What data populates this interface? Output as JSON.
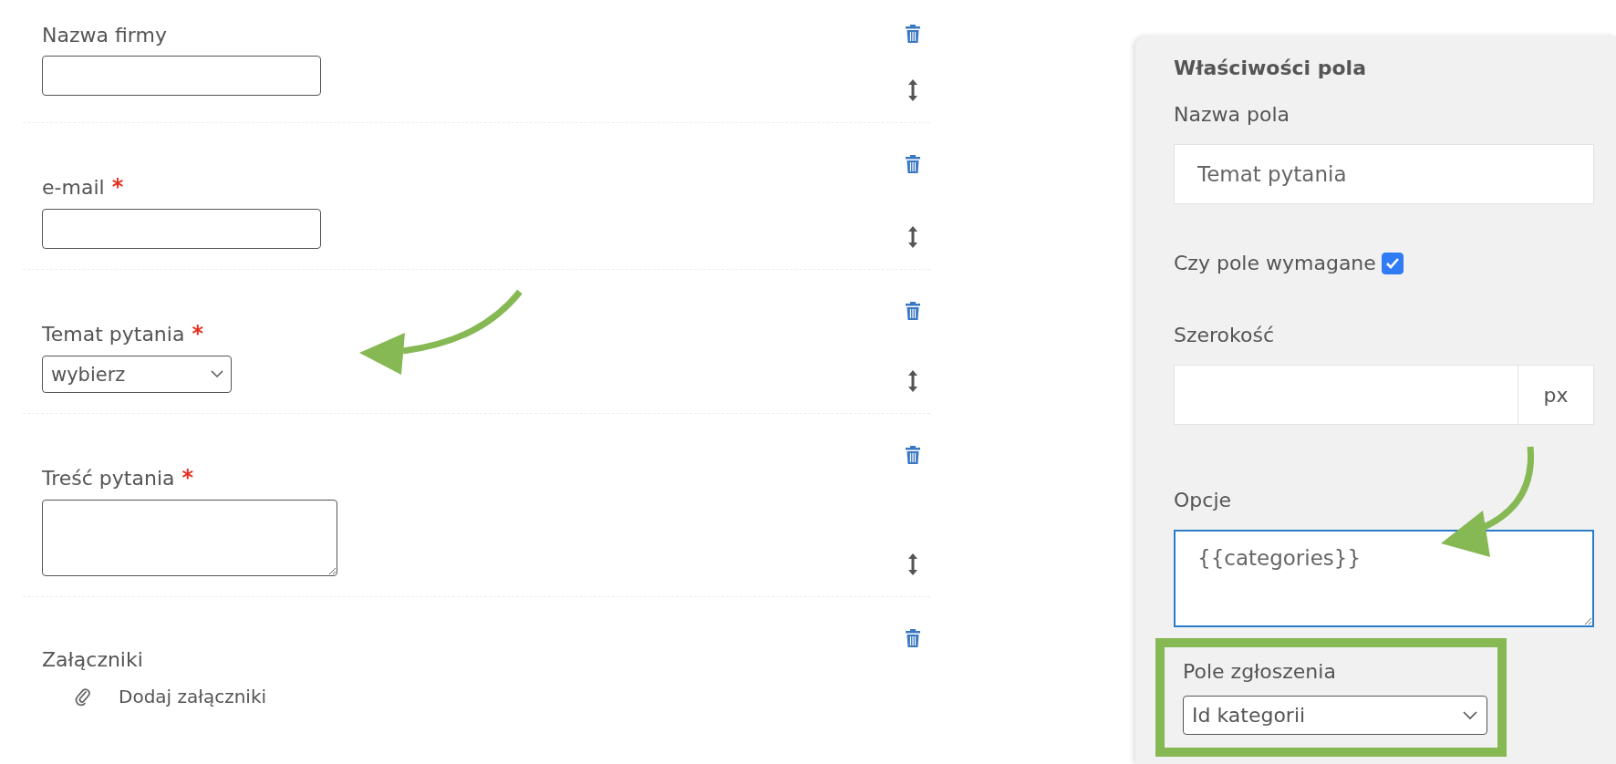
{
  "form_fields": [
    {
      "kind": "text",
      "label": "Nazwa firmy",
      "required": false
    },
    {
      "kind": "text",
      "label": "e-mail",
      "required": true
    },
    {
      "kind": "select",
      "label": "Temat pytania",
      "required": true,
      "value": "wybierz"
    },
    {
      "kind": "textarea",
      "label": "Treść pytania",
      "required": true
    },
    {
      "kind": "attachments",
      "label": "Załączniki",
      "required": false,
      "link": "Dodaj załączniki"
    }
  ],
  "required_mark": "*",
  "properties_panel": {
    "title": "Właściwości pola",
    "name_label": "Nazwa pola",
    "name_value": "Temat pytania",
    "required_label": "Czy pole wymagane",
    "required_checked": true,
    "width_label": "Szerokość",
    "width_unit": "px",
    "options_label": "Opcje",
    "options_value": "{{categories}}",
    "ticket_field_label": "Pole zgłoszenia",
    "ticket_field_value": "Id kategorii",
    "ticket_field_highlighted": true
  }
}
